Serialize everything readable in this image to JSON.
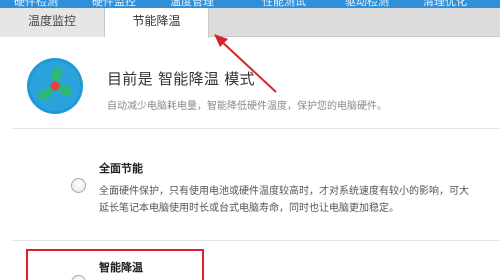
{
  "top_menu": {
    "items": [
      "硬件检测",
      "硬件监控",
      "温度管理",
      "性能测试",
      "驱动检测",
      "清理优化"
    ]
  },
  "tabs": [
    {
      "label": "温度监控"
    },
    {
      "label": "节能降温"
    }
  ],
  "header": {
    "title": "目前是 智能降温 模式",
    "subtitle": "自动减少电脑耗电量，智能降低硬件温度，保护您的电脑硬件。"
  },
  "options": [
    {
      "title": "全面节能",
      "desc_line1": "全面硬件保护，只有使用电池或硬件温度较高时，才对系统速度有较小的影响，可大",
      "desc_line2": "延长笔记本电脑使用时长或台式电脑寿命，同时也让电脑更加稳定。"
    },
    {
      "title": "智能降温"
    }
  ],
  "colors": {
    "accent": "#2f8fd8",
    "annotation": "#d9232c",
    "fan_bg": "#1f9ad6",
    "fan_blade": "#2db87a"
  },
  "icons": {
    "fan": "fan-icon",
    "radio": "radio-icon",
    "arrow": "annotation-arrow"
  }
}
